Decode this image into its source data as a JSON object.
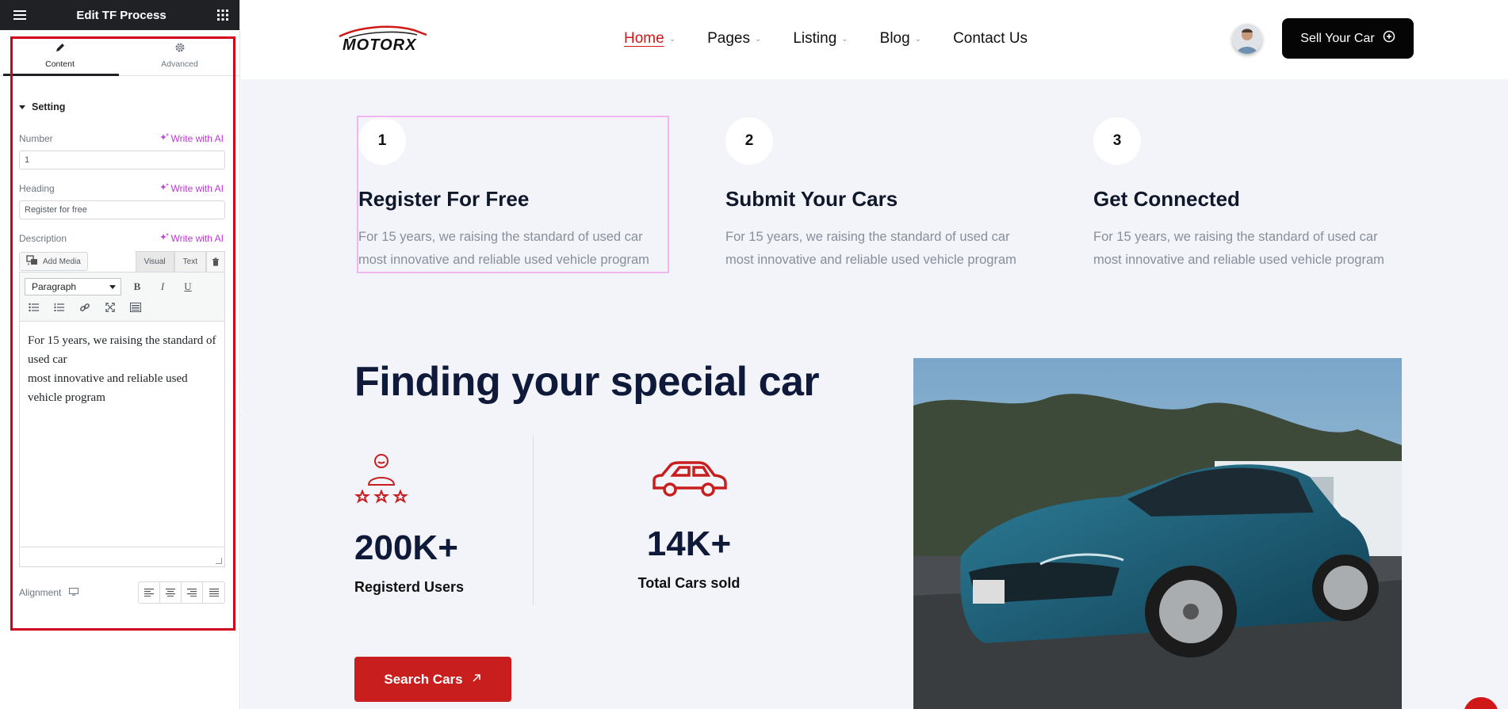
{
  "editor": {
    "title": "Edit TF Process",
    "tabs": [
      {
        "label": "Content",
        "icon": "pencil-icon"
      },
      {
        "label": "Advanced",
        "icon": "gear-icon"
      }
    ],
    "section_title": "Setting",
    "ai_label": "Write with AI",
    "fields": {
      "number": {
        "label": "Number",
        "value": "1"
      },
      "heading": {
        "label": "Heading",
        "value": "Register for free"
      },
      "description": {
        "label": "Description",
        "add_media": "Add Media",
        "visual_tab": "Visual",
        "text_tab": "Text",
        "format": "Paragraph",
        "content": "For 15 years, we raising the standard of used car\nmost innovative and reliable used vehicle program"
      },
      "alignment": {
        "label": "Alignment"
      }
    }
  },
  "site": {
    "logo_text": "MOTORX",
    "nav": [
      {
        "label": "Home",
        "active": true
      },
      {
        "label": "Pages"
      },
      {
        "label": "Listing"
      },
      {
        "label": "Blog"
      },
      {
        "label": "Contact Us"
      }
    ],
    "sell_button": "Sell Your Car",
    "steps": [
      {
        "number": "1",
        "title": "Register For Free",
        "desc": "For 15 years, we raising the standard of used car most innovative and reliable used vehicle program"
      },
      {
        "number": "2",
        "title": "Submit Your Cars",
        "desc": "For 15 years, we raising the standard of used car most innovative and reliable used vehicle program"
      },
      {
        "number": "3",
        "title": "Get Connected",
        "desc": "For 15 years, we raising the standard of used car most innovative and reliable used vehicle program"
      }
    ],
    "finding_title": "Finding your special car",
    "stats": [
      {
        "value": "200K+",
        "label": "Registerd Users",
        "icon": "user-rating-icon"
      },
      {
        "value": "14K+",
        "label": "Total Cars sold",
        "icon": "car-icon"
      }
    ],
    "search_button": "Search Cars",
    "colors": {
      "accent": "#c81e1e",
      "dark": "#0f1a3a",
      "ai": "#c036d8"
    }
  }
}
